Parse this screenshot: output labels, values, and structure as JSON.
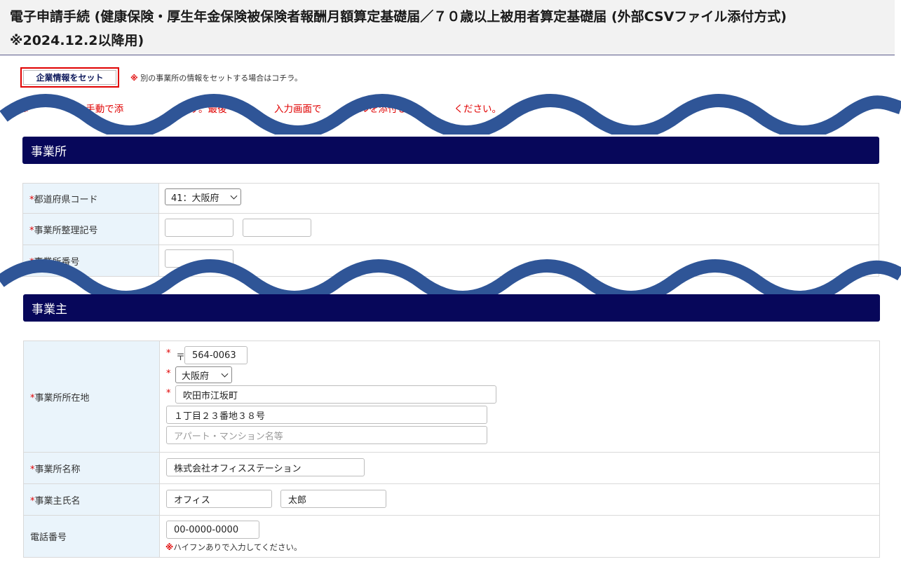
{
  "header": {
    "title_line1": "電子申請手続 (健康保険・厚生年金保険被保険者報酬月額算定基礎届／７０歳以上被用者算定基礎届 (外部CSVファイル添付方式)",
    "title_line2": "※2024.12.2以降用)"
  },
  "toolbar": {
    "set_company_label": "企業情報をセット",
    "note_mark": "※",
    "note_text": "別の事業所の情報をセットする場合はコチラ。"
  },
  "notice": {
    "visible_text": "※　　　　　を手動で添　　　　　　です。最後　　　　　入力画面で　　　　ルを添付し　　　　　ください。"
  },
  "office_section": {
    "title": "事業所",
    "required_mark": "*",
    "prefecture_label": "都道府県コード",
    "prefecture_value": "41：大阪府",
    "office_code_label": "事業所整理記号",
    "office_code_1": "",
    "office_code_2": "",
    "office_number_label": "事業所番号",
    "office_number": ""
  },
  "owner_section": {
    "title": "事業主",
    "required_mark": "*",
    "postal_symbol": "〒",
    "address_label": "事業所所在地",
    "postal_code": "564-0063",
    "prefecture": "大阪府",
    "city": "吹田市江坂町",
    "street": "１丁目２３番地３８号",
    "building_placeholder": "アパート・マンション名等",
    "name_label": "事業所名称",
    "office_name": "株式会社オフィスステーション",
    "owner_label": "事業主氏名",
    "owner_last": "オフィス",
    "owner_first": "太郎",
    "phone_label": "電話番号",
    "phone": "00-0000-0000",
    "phone_hint_mark": "※",
    "phone_hint": "ハイフンありで入力してください。"
  },
  "colors": {
    "section_header": "#07075a",
    "label_bg": "#eaf4fb",
    "required": "#e00000",
    "wave": "#2f5597"
  }
}
